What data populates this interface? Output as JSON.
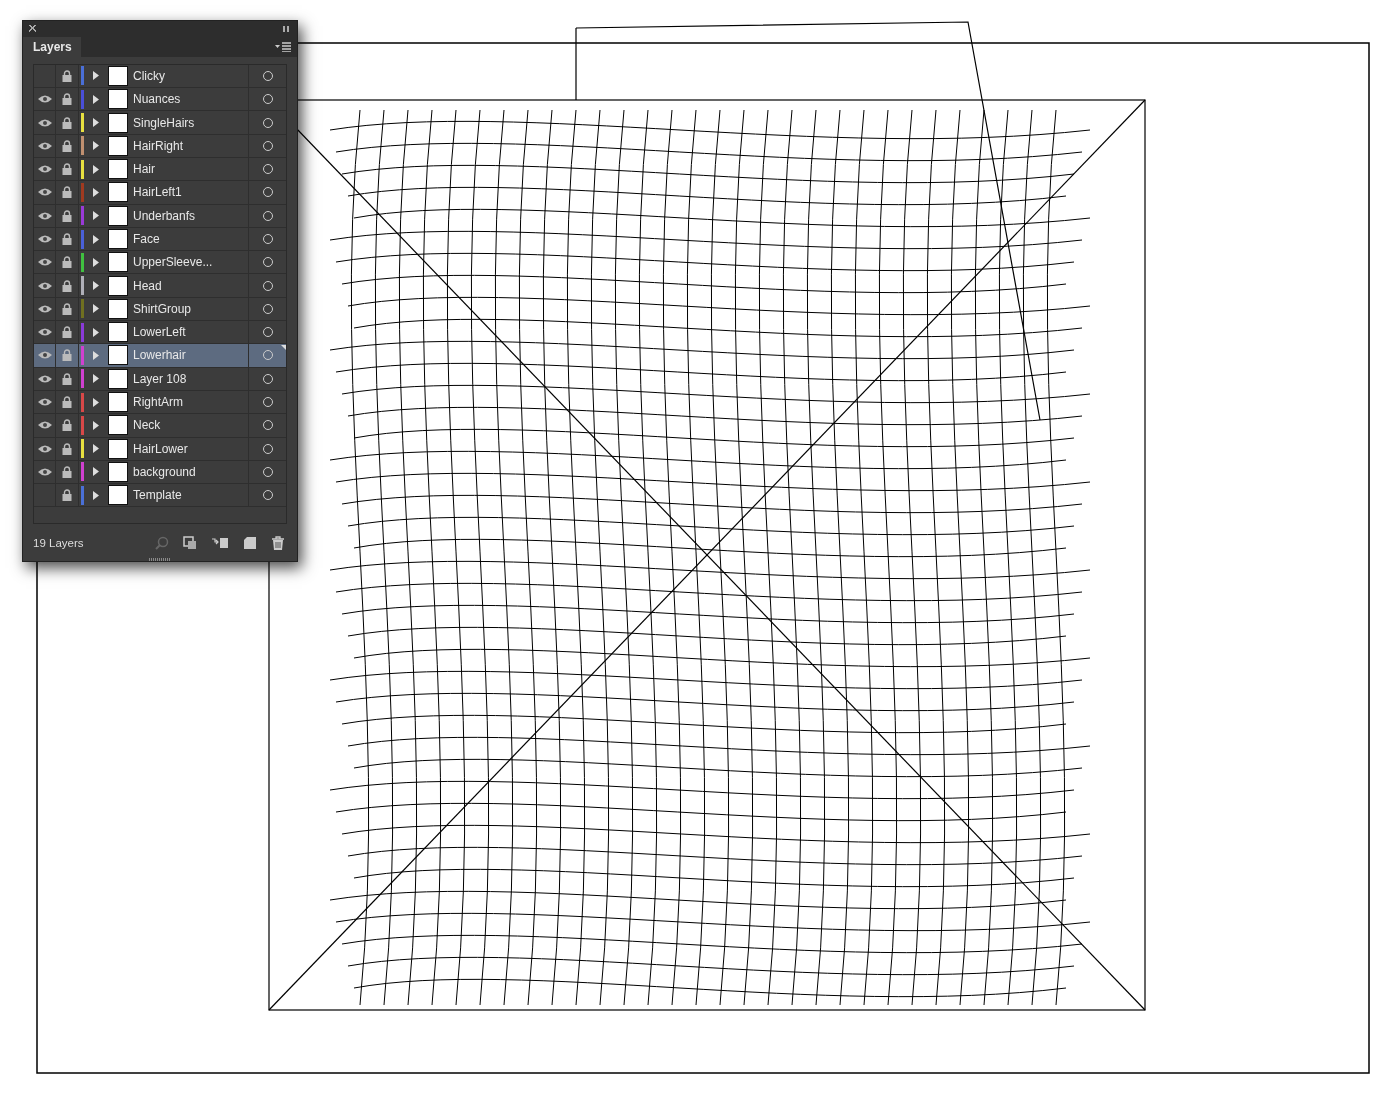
{
  "panel": {
    "title": "Layers",
    "layer_count": "19 Layers",
    "layers": [
      {
        "name": "Clicky",
        "visible": false,
        "color": "#4a6fd8",
        "selected": false
      },
      {
        "name": "Nuances",
        "visible": true,
        "color": "#4a4fd8",
        "selected": false
      },
      {
        "name": "SingleHairs",
        "visible": true,
        "color": "#e8e040",
        "selected": false
      },
      {
        "name": "HairRight",
        "visible": true,
        "color": "#c09070",
        "selected": false
      },
      {
        "name": "Hair",
        "visible": true,
        "color": "#e8e040",
        "selected": false
      },
      {
        "name": "HairLeft1",
        "visible": true,
        "color": "#a03a20",
        "selected": false
      },
      {
        "name": "Underbanfs",
        "visible": true,
        "color": "#9a3ad8",
        "selected": false
      },
      {
        "name": "Face",
        "visible": true,
        "color": "#4a60d8",
        "selected": false
      },
      {
        "name": "UpperSleeve...",
        "visible": true,
        "color": "#40c040",
        "selected": false
      },
      {
        "name": "Head",
        "visible": true,
        "color": "#b0b0b8",
        "selected": false
      },
      {
        "name": "ShirtGroup",
        "visible": true,
        "color": "#707020",
        "selected": false
      },
      {
        "name": "LowerLeft",
        "visible": true,
        "color": "#8a3ad8",
        "selected": false
      },
      {
        "name": "Lowerhair",
        "visible": true,
        "color": "#d040d0",
        "selected": true
      },
      {
        "name": "Layer 108",
        "visible": true,
        "color": "#d040d0",
        "selected": false
      },
      {
        "name": "RightArm",
        "visible": true,
        "color": "#d84848",
        "selected": false
      },
      {
        "name": "Neck",
        "visible": true,
        "color": "#d84848",
        "selected": false
      },
      {
        "name": "HairLower",
        "visible": true,
        "color": "#e8e040",
        "selected": false
      },
      {
        "name": "background",
        "visible": true,
        "color": "#d040d0",
        "selected": false
      },
      {
        "name": "Template",
        "visible": false,
        "color": "#4a70d8",
        "selected": false
      }
    ]
  }
}
